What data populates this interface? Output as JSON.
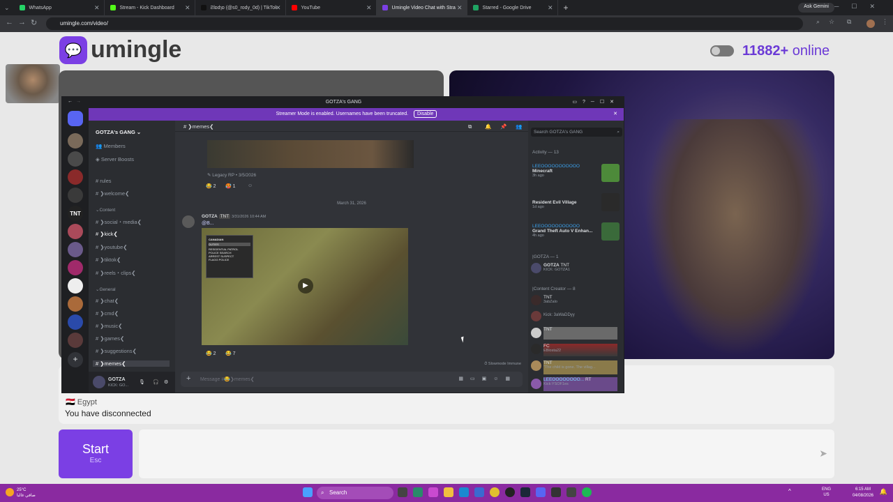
{
  "browser": {
    "tabs": [
      {
        "label": "WhatsApp",
        "color": "#25d366"
      },
      {
        "label": "Stream - Kick Dashboard",
        "color": "#53fc18"
      },
      {
        "label": "Ƨlɒdɿɒ (@s0_rody_0d) | TikTok",
        "color": "#111111"
      },
      {
        "label": "YouTube",
        "color": "#ff0000"
      },
      {
        "label": "Umingle Video Chat with Stra",
        "color": "#7b3fe4"
      },
      {
        "label": "Starred - Google Drive",
        "color": "#1fa463"
      }
    ],
    "ask_gemini": "Ask Gemini",
    "url": "umingle.com/video/"
  },
  "umingle": {
    "logo": "umingle",
    "online_count": "11882+",
    "online_label": "online",
    "country": "Egypt",
    "status": "You have disconnected",
    "start_label": "Start",
    "start_shortcut": "Esc"
  },
  "discord": {
    "window_title": "GOTZA's GANG",
    "banner_text": "Streamer Mode is enabled. Usernames have been truncated.",
    "banner_button": "Disable",
    "server_name": "GOTZA's GANG",
    "nav_members": "Members",
    "nav_boosts": "Server Boosts",
    "channels": {
      "rules": "rules",
      "welcome": "❯welcome❮",
      "cat_content": "Content",
      "social": "❯social・media❮",
      "kick": "❯kick❮",
      "youtube": "❯youtube❮",
      "tiktok": "❯tiktok❮",
      "reels": "❯reels・clips❮",
      "cat_general": "General",
      "chat": "❯chat❮",
      "cmd": "❯cmd❮",
      "music": "❯music❮",
      "games": "❯games❮",
      "suggestions": "❯suggestions❮",
      "memes": "❯memes❮"
    },
    "user": {
      "name": "GOTZA",
      "sub": "KICK: GO..."
    },
    "header_channel": "❯memes❮",
    "search_placeholder": "Search GOTZA's GANG",
    "embed_source": "Legacy RP • 3/5/2026",
    "reaction1": "2",
    "reaction2": "1",
    "date_divider": "March 31, 2026",
    "msg_author": "GOTZA",
    "msg_tag": "TNT",
    "msg_time": "3/31/2026 10:44 AM",
    "msg_text": "@B...",
    "menu_title": "CANADIAN",
    "menu_items": [
      "DUTIES",
      "RESIDENTIAL PATROL",
      "POLICE SEARCH",
      "ARREST SUSPECT",
      "FLAGG POLICE"
    ],
    "reaction3": "2",
    "reaction4": "7",
    "slowmode": "Slowmode Immune",
    "composer_placeholder": "Message #😂❯memes❮",
    "activity_header": "Activity — 13",
    "activities": [
      {
        "user": "LEEOOOOOOOOOOO",
        "game": "Minecraft",
        "time": "3h ago",
        "color": "#4d8a3a"
      },
      {
        "user": "",
        "game": "Resident Evil Village",
        "time": "1d ago",
        "color": "#2a2a2a"
      },
      {
        "user": "LEEOOOOOOOOOOO",
        "game": "Grand Theft Auto V Enhan...",
        "time": "4h ago",
        "color": "#3a6a3a"
      }
    ],
    "group1": "|GOTZA — 1",
    "gotza_name": "GOTZA",
    "gotza_tag": "TNT",
    "gotza_sub": "KICK: GOTZA1",
    "group2": "|Content Creator — 8",
    "members": [
      {
        "name": "",
        "tag": "TNT",
        "sub": "3abZalo"
      },
      {
        "name": "",
        "tag": "",
        "sub": "Kick: 3aWaDDyy"
      },
      {
        "name": "",
        "tag": "TNT",
        "sub": ""
      },
      {
        "name": "",
        "tag": "FC",
        "sub": "EBlosta22"
      },
      {
        "name": "",
        "tag": "TNT",
        "sub": "\"The child is gone. The villag..."
      },
      {
        "name": "LEEOOOOOOOO...",
        "tag": "RT",
        "sub": "Kick:YSOF1es"
      }
    ]
  },
  "taskbar": {
    "weather_temp": "25°C",
    "weather_text": "صافي غالبا",
    "search": "Search",
    "lang": "ENG",
    "lang2": "US",
    "time": "6:15 AM",
    "date": "04/08/2026"
  }
}
